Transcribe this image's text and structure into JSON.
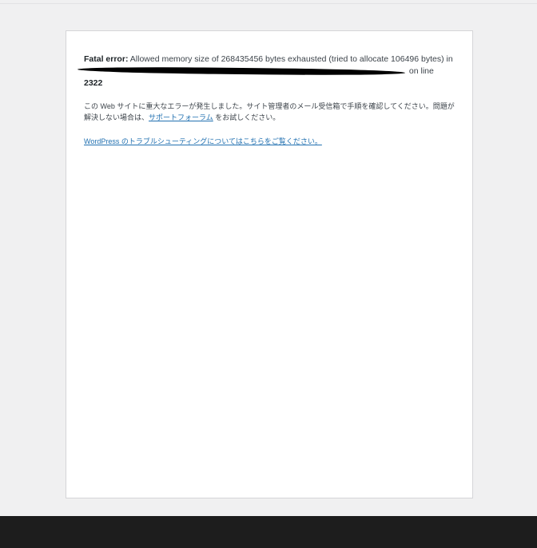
{
  "error": {
    "label": "Fatal error",
    "colon": ":",
    "message": " Allowed memory size of 268435456 bytes exhausted (tried to allocate 106496 bytes) in",
    "on_line": "on line",
    "line_number": "2322"
  },
  "notice": {
    "text_before": "この Web サイトに重大なエラーが発生しました。サイト管理者のメール受信箱で手順を確認してください。問題が解決しない場合は、",
    "support_link": "サポートフォーラム",
    "text_after": " をお試しください。"
  },
  "troubleshoot": {
    "link": "WordPress のトラブルシューティングについてはこちらをご覧ください。"
  },
  "colors": {
    "background": "#f0f0f1",
    "card": "#ffffff",
    "link": "#2271b1",
    "bottom_bar": "#1d1d1d"
  }
}
